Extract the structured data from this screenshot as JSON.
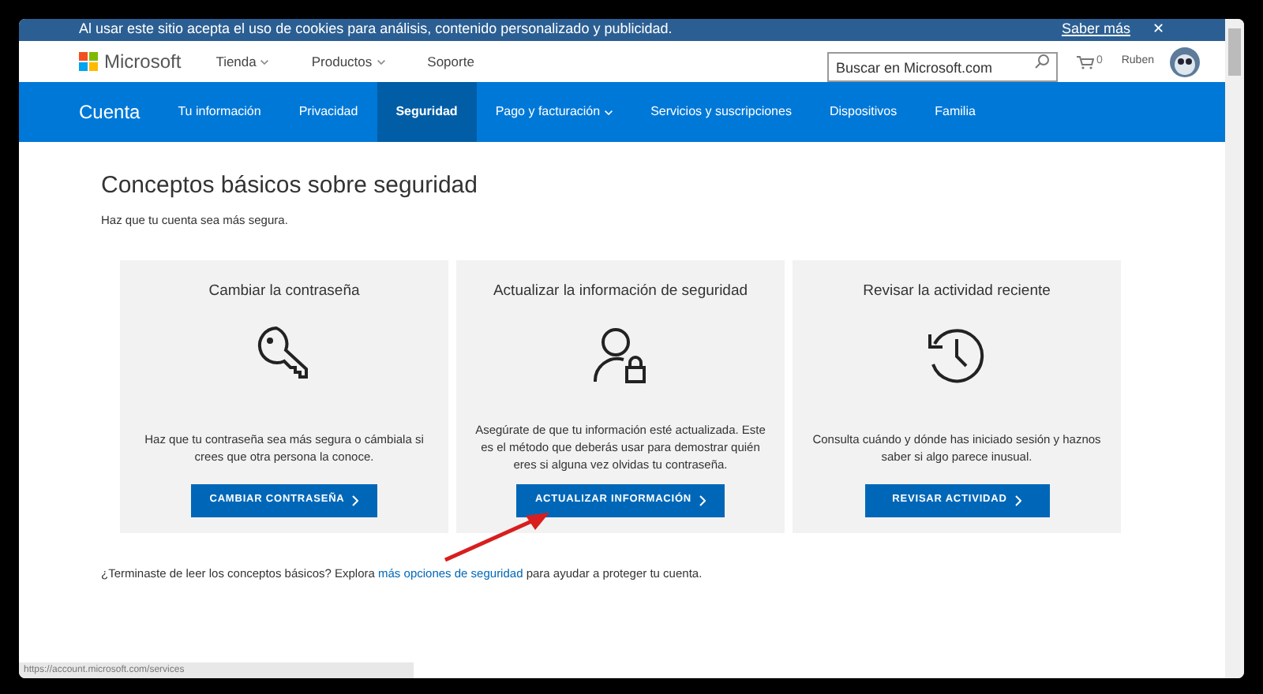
{
  "cookie_bar": {
    "text": "Al usar este sitio acepta el uso de cookies para análisis, contenido personalizado y publicidad.",
    "link": "Saber más",
    "close": "✕"
  },
  "header": {
    "brand": "Microsoft",
    "menu": [
      {
        "label": "Tienda",
        "dropdown": true
      },
      {
        "label": "Productos",
        "dropdown": true
      },
      {
        "label": "Soporte",
        "dropdown": false
      }
    ],
    "search": {
      "placeholder": "Buscar en Microsoft.com"
    },
    "cart_count": "0",
    "user": "Ruben"
  },
  "nav": {
    "title": "Cuenta",
    "items": [
      {
        "label": "Tu información",
        "selected": false,
        "dropdown": false
      },
      {
        "label": "Privacidad",
        "selected": false,
        "dropdown": false
      },
      {
        "label": "Seguridad",
        "selected": true,
        "dropdown": false
      },
      {
        "label": "Pago y facturación",
        "selected": false,
        "dropdown": true
      },
      {
        "label": "Servicios y suscripciones",
        "selected": false,
        "dropdown": false
      },
      {
        "label": "Dispositivos",
        "selected": false,
        "dropdown": false
      },
      {
        "label": "Familia",
        "selected": false,
        "dropdown": false
      }
    ]
  },
  "page": {
    "title": "Conceptos básicos sobre seguridad",
    "subtitle": "Haz que tu cuenta sea más segura."
  },
  "cards": [
    {
      "title": "Cambiar la contraseña",
      "kind": "key",
      "text": "Haz que tu contraseña sea más segura o cámbiala si crees que otra persona la conoce.",
      "button": "CAMBIAR CONTRASEÑA"
    },
    {
      "title": "Actualizar la información de seguridad",
      "kind": "user-lock",
      "text": "Asegúrate de que tu información esté actualizada. Este es el método que deberás usar para demostrar quién eres si alguna vez olvidas tu contraseña.",
      "button": "ACTUALIZAR INFORMACIÓN"
    },
    {
      "title": "Revisar la actividad reciente",
      "kind": "history",
      "text": "Consulta cuándo y dónde has iniciado sesión y haznos saber si algo parece inusual.",
      "button": "REVISAR ACTIVIDAD"
    }
  ],
  "footer_note": {
    "before": "¿Terminaste de leer los conceptos básicos? Explora ",
    "link": "más opciones de seguridad",
    "after": " para ayudar a proteger tu cuenta."
  },
  "status_bar": {
    "url": "https://account.microsoft.com/services"
  }
}
